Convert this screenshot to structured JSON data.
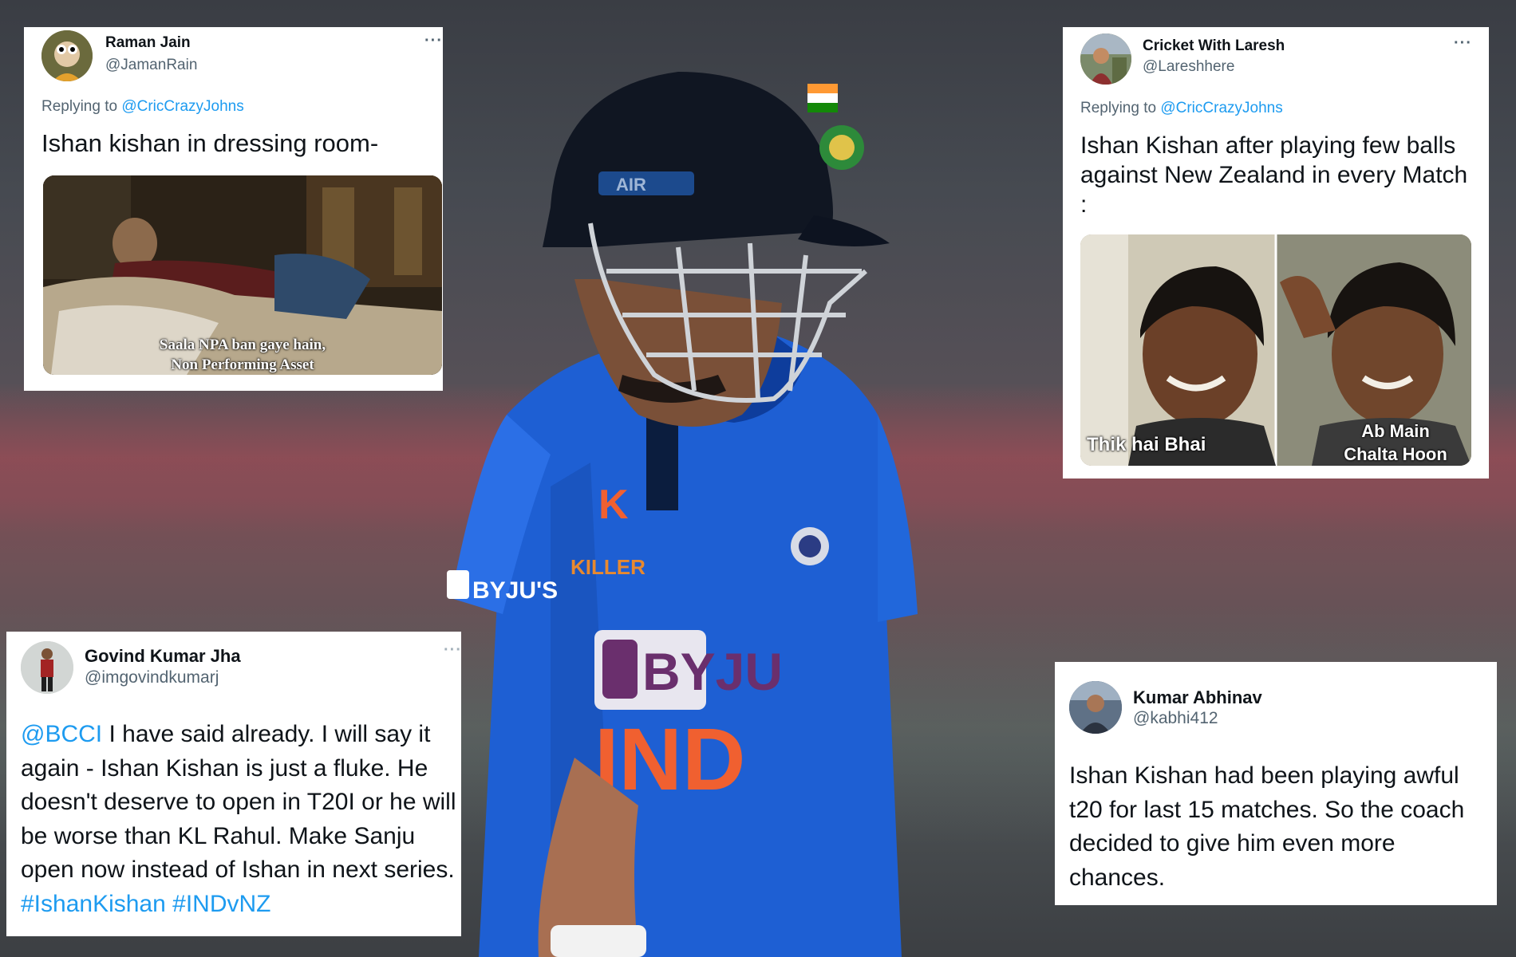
{
  "ui": {
    "replying_to": "Replying to",
    "more": "···"
  },
  "tweets": [
    {
      "name": "Raman Jain",
      "handle": "@JamanRain",
      "reply_to": "@CricCrazyJohns",
      "text": "Ishan kishan in dressing room-",
      "media_caption": [
        "Saala NPA ban gaye hain,",
        "Non Performing Asset"
      ]
    },
    {
      "name": "Cricket With Laresh",
      "handle": "@Lareshhere",
      "reply_to": "@CricCrazyJohns",
      "text": "Ishan Kishan after playing few balls against New Zealand in every Match :",
      "media_caption_left": "Thik hai Bhai",
      "media_caption_right": [
        "Ab Main",
        "Chalta Hoon"
      ]
    },
    {
      "name": "Govind Kumar Jha",
      "handle": "@imgovindkumarj",
      "mention": "@BCCI",
      "text": "I have said already. I will say it again - Ishan Kishan is just a fluke. He doesn't deserve to open in T20I or he will be worse than KL Rahul. Make Sanju open now instead of Ishan in next series.",
      "hashtags": [
        "#IshanKishan",
        "#INDvNZ"
      ]
    },
    {
      "name": "Kumar Abhinav",
      "handle": "@kabhi412",
      "text": "Ishan Kishan had been playing awful t20 for last 15 matches. So the coach decided to give him even more chances."
    }
  ],
  "colors": {
    "link": "#1d9bf0",
    "secondary_text": "#536471",
    "primary_text": "#0f1419",
    "card_background": "#ffffff"
  }
}
